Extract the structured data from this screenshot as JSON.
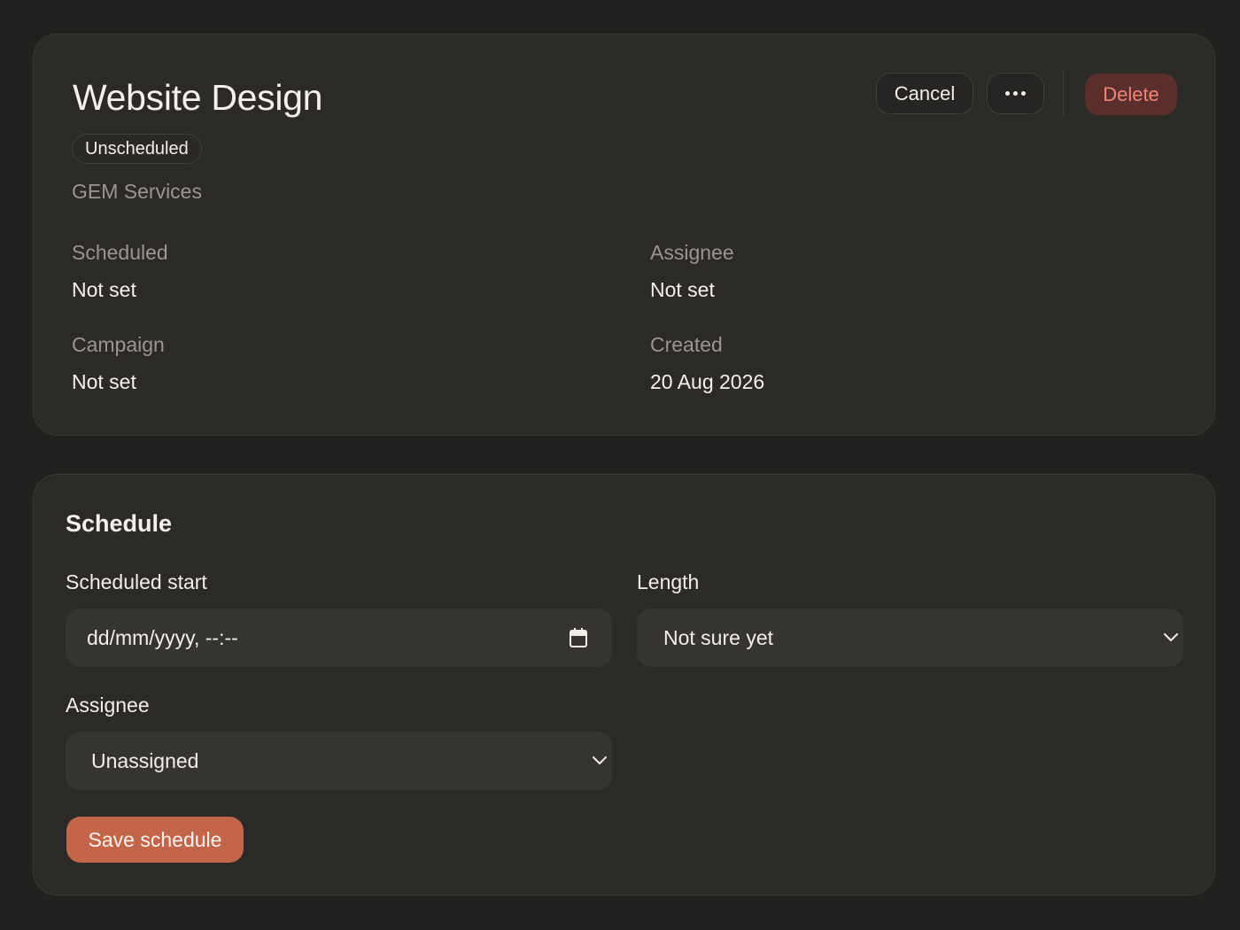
{
  "task": {
    "title": "Website Design",
    "status_badge": "Unscheduled",
    "client": "GEM Services"
  },
  "actions": {
    "cancel_label": "Cancel",
    "more_icon": "ellipsis-icon",
    "delete_label": "Delete"
  },
  "details": {
    "scheduled_label": "Scheduled",
    "scheduled_value": "Not set",
    "assignee_label": "Assignee",
    "assignee_value": "Not set",
    "campaign_label": "Campaign",
    "campaign_value": "Not set",
    "created_label": "Created",
    "created_value": "20 Aug 2026"
  },
  "schedule": {
    "title": "Schedule",
    "start_label": "Scheduled start",
    "start_placeholder": "dd/mm/yyyy, --:--",
    "length_label": "Length",
    "length_value": "Not sure yet",
    "assignee_label": "Assignee",
    "assignee_value": "Unassigned",
    "save_label": "Save schedule"
  },
  "colors": {
    "background": "#212120",
    "card": "#2b2a27",
    "accent": "#c2654a",
    "danger_text": "#f08478",
    "danger_bg": "#5a2f2b"
  }
}
